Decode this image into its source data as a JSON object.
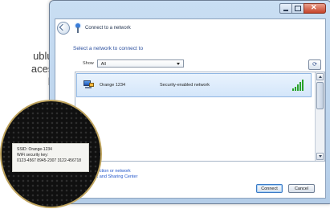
{
  "background_text": [
    "ublu-",
    "acest",
    "k."
  ],
  "window": {
    "title": "Connect to a network",
    "heading": "Select a network to connect to",
    "show": {
      "label": "Show",
      "value": "All"
    },
    "networks": [
      {
        "name": "Orange 1234",
        "status": "Security-enabled network",
        "signal": "5 of 5 bars"
      }
    ],
    "links": [
      "...nnection or network",
      "...ork and Sharing Center"
    ],
    "buttons": {
      "connect": "Connect",
      "cancel": "Cancel"
    }
  },
  "router_label": {
    "lines": [
      "SSID: Orange-1234",
      "WiFi security key:",
      "0123-4567 8945-2307 3122-456718"
    ]
  },
  "colors": {
    "link_blue": "#1f54c9",
    "heading_blue": "#2b4f9e",
    "signal_green": "#29a329",
    "selection": "#d4e6fa"
  }
}
